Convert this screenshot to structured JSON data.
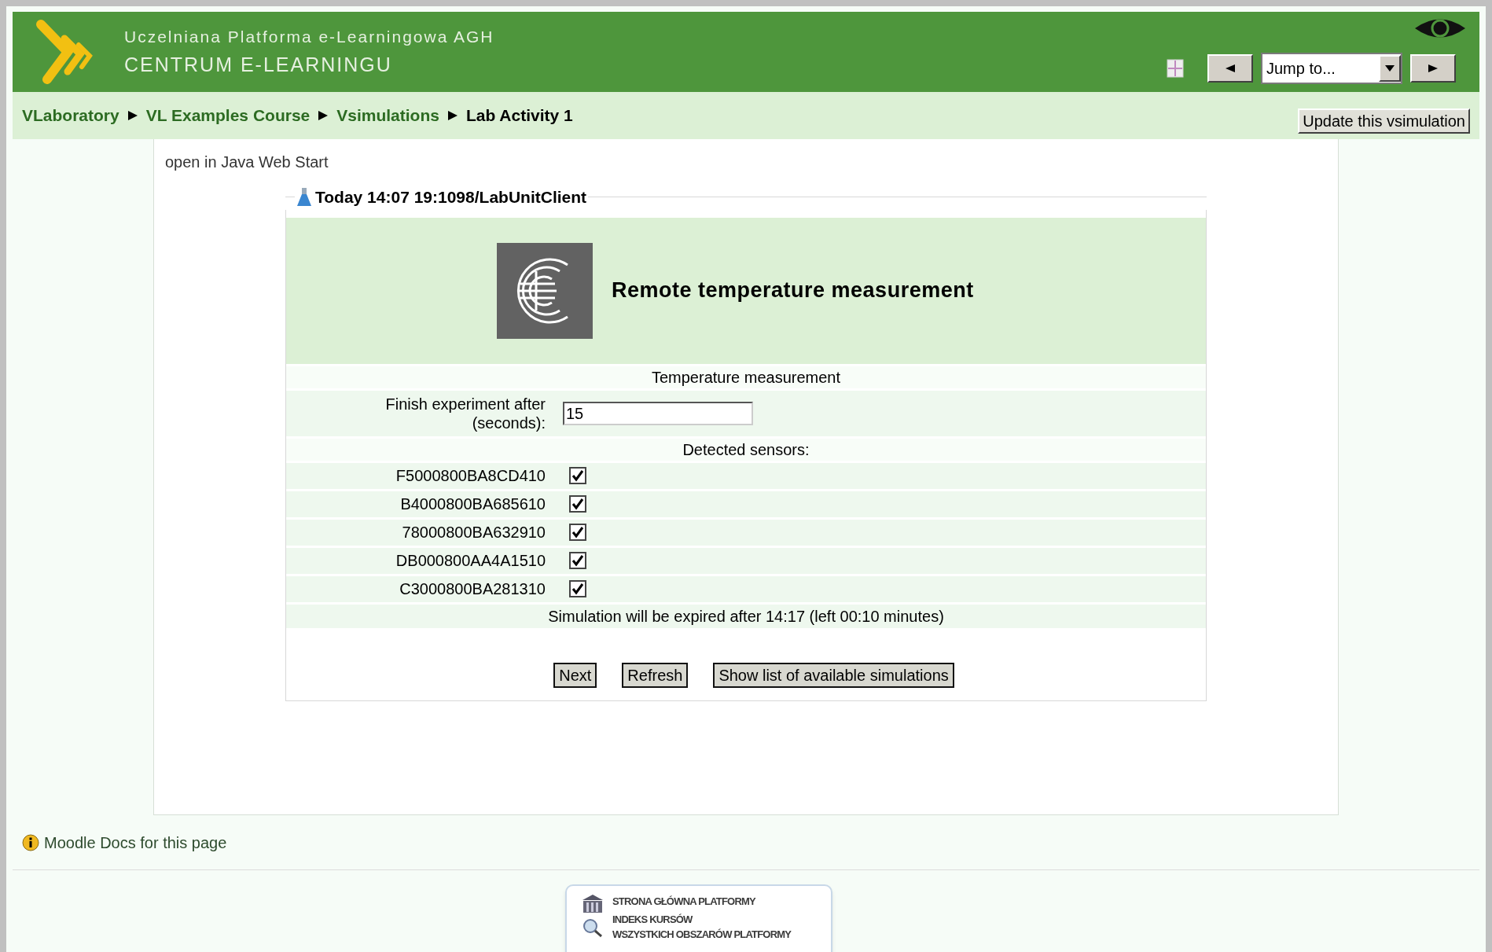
{
  "header": {
    "subtitle": "Uczelniana Platforma e-Learningowa AGH",
    "title": "CENTRUM E-LEARNINGU",
    "jump": {
      "value": "Jump to..."
    }
  },
  "breadcrumb": [
    {
      "label": "VLaboratory",
      "current": false
    },
    {
      "label": "VL Examples Course",
      "current": false
    },
    {
      "label": "Vsimulations",
      "current": false
    },
    {
      "label": "Lab Activity 1",
      "current": true
    }
  ],
  "update_button": "Update this vsimulation",
  "java_link": "open in Java Web Start",
  "legend": "Today 14:07 19:1098/LabUnitClient",
  "activity_title": "Remote temperature measurement",
  "section_title": "Temperature measurement",
  "finish": {
    "label": "Finish experiment after (seconds):",
    "value": "15"
  },
  "sensors_title": "Detected sensors:",
  "sensors": [
    {
      "id": "F5000800BA8CD410",
      "checked": true
    },
    {
      "id": "B4000800BA685610",
      "checked": true
    },
    {
      "id": "78000800BA632910",
      "checked": true
    },
    {
      "id": "DB000800AA4A1510",
      "checked": true
    },
    {
      "id": "C3000800BA281310",
      "checked": true
    }
  ],
  "expiry": "Simulation will be expired after 14:17 (left 00:10 minutes)",
  "buttons": [
    "Next",
    "Refresh",
    "Show list of available simulations"
  ],
  "docs_link": "Moodle Docs for this page",
  "footer_menu": [
    "STRONA GŁÓWNA PLATFORMY",
    "INDEKS KURSÓW",
    "WSZYSTKICH OBSZARÓW PLATFORMY"
  ]
}
